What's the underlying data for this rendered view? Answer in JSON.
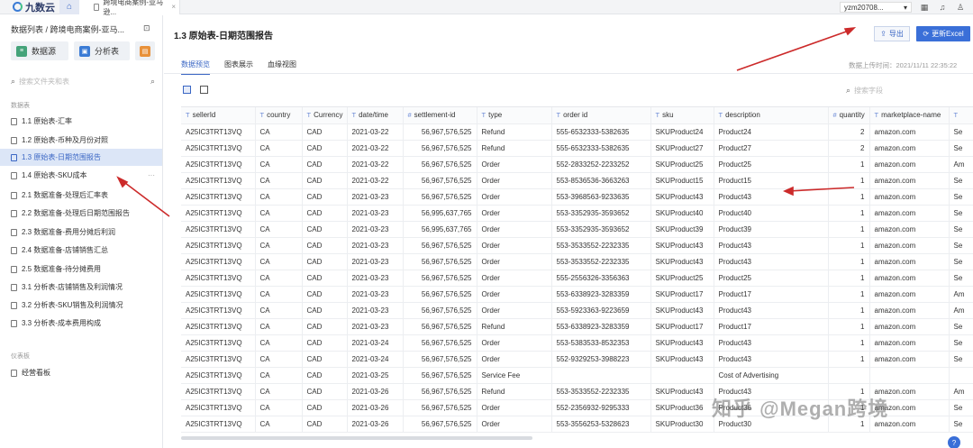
{
  "topbar": {
    "logo_text": "九数云",
    "doc_tab_label": "跨境电商案例-亚马逊...",
    "user_name": "yzm20708...",
    "colors": {
      "accent": "#3a66c4",
      "primary_button": "#3a6fd8",
      "active_row": "#dce6f7"
    }
  },
  "sidebar": {
    "breadcrumb": "数据列表 / 跨境电商案例-亚马...",
    "datasource_label": "数据源",
    "analysis_label": "分析表",
    "search_placeholder": "搜索文件夹和表",
    "section_data": "数据表",
    "section_dashboard": "仪表板",
    "items": [
      {
        "label": "1.1 原始表-汇率"
      },
      {
        "label": "1.2 原始表-币种及月份对照"
      },
      {
        "label": "1.3 原始表-日期范围报告"
      },
      {
        "label": "1.4 原始表-SKU成本"
      },
      {
        "label": "2.1 数据准备-处理后汇率表"
      },
      {
        "label": "2.2 数据准备-处理后日期范围报告"
      },
      {
        "label": "2.3 数据准备-费用分摊后利润"
      },
      {
        "label": "2.4 数据准备-店铺销售汇总"
      },
      {
        "label": "2.5 数据准备-待分摊费用"
      },
      {
        "label": "3.1 分析表-店铺销售及利润情况"
      },
      {
        "label": "3.2 分析表-SKU销售及利润情况"
      },
      {
        "label": "3.3 分析表-成本费用构成"
      }
    ],
    "dashboard_item": "经营看板"
  },
  "main": {
    "title": "1.3 原始表-日期范围报告",
    "export_label": "导出",
    "update_label": "更新Excel",
    "tabs": [
      {
        "label": "数据预览"
      },
      {
        "label": "图表展示"
      },
      {
        "label": "血缘视图"
      }
    ],
    "upload_time": "数据上传时间：2021/11/11 22:35:22",
    "grid_search_placeholder": "搜索字段"
  },
  "table": {
    "columns": [
      {
        "label": "sellerId",
        "type": "T"
      },
      {
        "label": "country",
        "type": "T"
      },
      {
        "label": "Currency",
        "type": "T"
      },
      {
        "label": "date/time",
        "type": "T"
      },
      {
        "label": "settlement-id",
        "type": "#"
      },
      {
        "label": "type",
        "type": "T"
      },
      {
        "label": "order id",
        "type": "T"
      },
      {
        "label": "sku",
        "type": "T"
      },
      {
        "label": "description",
        "type": "T"
      },
      {
        "label": "quantity",
        "type": "#"
      },
      {
        "label": "marketplace-name",
        "type": "T"
      },
      {
        "label": "",
        "type": "T"
      }
    ],
    "rows": [
      [
        "A25IC3TRT13VQ",
        "CA",
        "CAD",
        "2021-03-22",
        "56,967,576,525",
        "Refund",
        "555-6532333-5382635",
        "SKUProduct24",
        "Product24",
        "2",
        "amazon.com",
        "Se"
      ],
      [
        "A25IC3TRT13VQ",
        "CA",
        "CAD",
        "2021-03-22",
        "56,967,576,525",
        "Refund",
        "555-6532333-5382635",
        "SKUProduct27",
        "Product27",
        "2",
        "amazon.com",
        "Se"
      ],
      [
        "A25IC3TRT13VQ",
        "CA",
        "CAD",
        "2021-03-22",
        "56,967,576,525",
        "Order",
        "552-2833252-2233252",
        "SKUProduct25",
        "Product25",
        "1",
        "amazon.com",
        "Am"
      ],
      [
        "A25IC3TRT13VQ",
        "CA",
        "CAD",
        "2021-03-22",
        "56,967,576,525",
        "Order",
        "553-8536536-3663263",
        "SKUProduct15",
        "Product15",
        "1",
        "amazon.com",
        "Se"
      ],
      [
        "A25IC3TRT13VQ",
        "CA",
        "CAD",
        "2021-03-23",
        "56,967,576,525",
        "Order",
        "553-3968563-9233635",
        "SKUProduct43",
        "Product43",
        "1",
        "amazon.com",
        "Se"
      ],
      [
        "A25IC3TRT13VQ",
        "CA",
        "CAD",
        "2021-03-23",
        "56,995,637,765",
        "Order",
        "553-3352935-3593652",
        "SKUProduct40",
        "Product40",
        "1",
        "amazon.com",
        "Se"
      ],
      [
        "A25IC3TRT13VQ",
        "CA",
        "CAD",
        "2021-03-23",
        "56,995,637,765",
        "Order",
        "553-3352935-3593652",
        "SKUProduct39",
        "Product39",
        "1",
        "amazon.com",
        "Se"
      ],
      [
        "A25IC3TRT13VQ",
        "CA",
        "CAD",
        "2021-03-23",
        "56,967,576,525",
        "Order",
        "553-3533552-2232335",
        "SKUProduct43",
        "Product43",
        "1",
        "amazon.com",
        "Se"
      ],
      [
        "A25IC3TRT13VQ",
        "CA",
        "CAD",
        "2021-03-23",
        "56,967,576,525",
        "Order",
        "553-3533552-2232335",
        "SKUProduct43",
        "Product43",
        "1",
        "amazon.com",
        "Se"
      ],
      [
        "A25IC3TRT13VQ",
        "CA",
        "CAD",
        "2021-03-23",
        "56,967,576,525",
        "Order",
        "555-2556326-3356363",
        "SKUProduct25",
        "Product25",
        "1",
        "amazon.com",
        "Se"
      ],
      [
        "A25IC3TRT13VQ",
        "CA",
        "CAD",
        "2021-03-23",
        "56,967,576,525",
        "Order",
        "553-6338923-3283359",
        "SKUProduct17",
        "Product17",
        "1",
        "amazon.com",
        "Am"
      ],
      [
        "A25IC3TRT13VQ",
        "CA",
        "CAD",
        "2021-03-23",
        "56,967,576,525",
        "Order",
        "553-5923363-9223659",
        "SKUProduct43",
        "Product43",
        "1",
        "amazon.com",
        "Am"
      ],
      [
        "A25IC3TRT13VQ",
        "CA",
        "CAD",
        "2021-03-23",
        "56,967,576,525",
        "Refund",
        "553-6338923-3283359",
        "SKUProduct17",
        "Product17",
        "1",
        "amazon.com",
        "Se"
      ],
      [
        "A25IC3TRT13VQ",
        "CA",
        "CAD",
        "2021-03-24",
        "56,967,576,525",
        "Order",
        "553-5383533-8532353",
        "SKUProduct43",
        "Product43",
        "1",
        "amazon.com",
        "Se"
      ],
      [
        "A25IC3TRT13VQ",
        "CA",
        "CAD",
        "2021-03-24",
        "56,967,576,525",
        "Order",
        "552-9329253-3988223",
        "SKUProduct43",
        "Product43",
        "1",
        "amazon.com",
        "Se"
      ],
      [
        "A25IC3TRT13VQ",
        "CA",
        "CAD",
        "2021-03-25",
        "56,967,576,525",
        "Service Fee",
        "",
        "",
        "Cost of Advertising",
        "",
        "",
        ""
      ],
      [
        "A25IC3TRT13VQ",
        "CA",
        "CAD",
        "2021-03-26",
        "56,967,576,525",
        "Refund",
        "553-3533552-2232335",
        "SKUProduct43",
        "Product43",
        "1",
        "amazon.com",
        "Am"
      ],
      [
        "A25IC3TRT13VQ",
        "CA",
        "CAD",
        "2021-03-26",
        "56,967,576,525",
        "Order",
        "552-2356932-9295333",
        "SKUProduct36",
        "Product36",
        "1",
        "amazon.com",
        "Se"
      ],
      [
        "A25IC3TRT13VQ",
        "CA",
        "CAD",
        "2021-03-26",
        "56,967,576,525",
        "Order",
        "553-3556253-5328623",
        "SKUProduct30",
        "Product30",
        "1",
        "amazon.com",
        "Se"
      ]
    ]
  },
  "overlay": {
    "watermark": "知乎 @Megan跨境"
  }
}
